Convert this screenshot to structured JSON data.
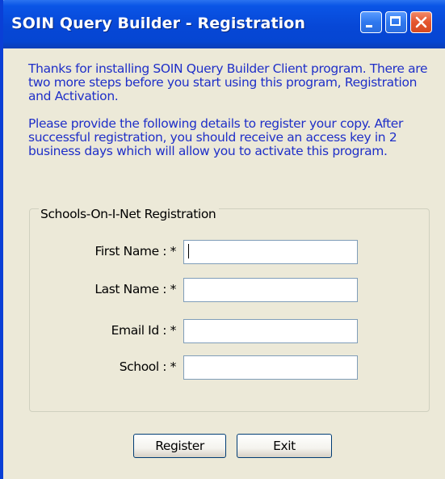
{
  "window": {
    "title": "SOIN Query Builder - Registration"
  },
  "title_buttons": {
    "minimize": "minimize-icon",
    "maximize": "maximize-icon",
    "close": "close-icon"
  },
  "intro": {
    "paragraph1": "Thanks for installing SOIN Query Builder Client program. There are two more steps before you start using this program, Registration and Activation.",
    "paragraph2": "Please provide the following details to register your copy. After successful registration, you should receive an access key in 2 business days which will allow you to activate this program."
  },
  "form": {
    "group_title": "Schools-On-I-Net Registration",
    "fields": [
      {
        "label": "First Name : *",
        "value": ""
      },
      {
        "label": "Last Name : *",
        "value": ""
      },
      {
        "label": "Email Id : *",
        "value": ""
      },
      {
        "label": "School : *",
        "value": ""
      }
    ]
  },
  "buttons": {
    "register": "Register",
    "exit": "Exit"
  },
  "colors": {
    "title_bar": "#0747d6",
    "intro_text": "#1f2fc8",
    "dialog_bg": "#ece9d8",
    "close_button": "#e4552e"
  }
}
